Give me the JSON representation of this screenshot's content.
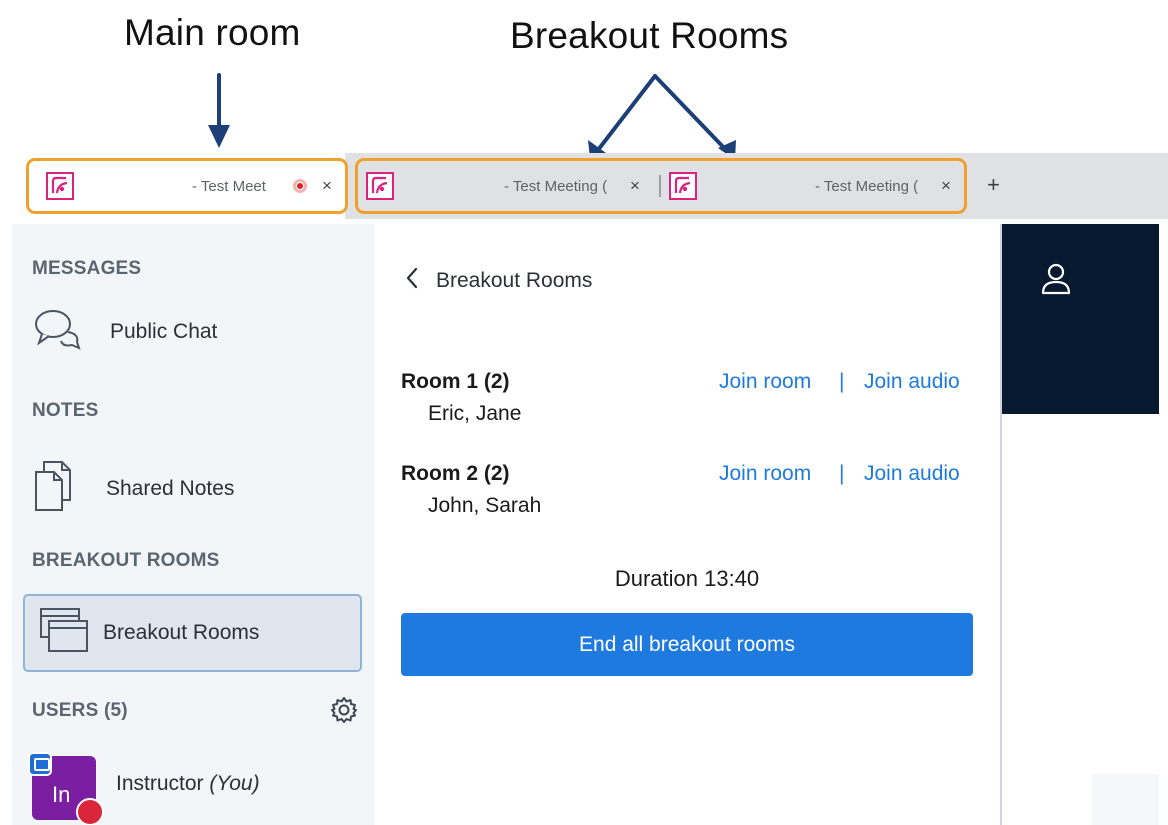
{
  "annotations": {
    "main_room": "Main room",
    "breakout_rooms": "Breakout Rooms"
  },
  "tabs": [
    {
      "title": "- Test Meet",
      "recording": true,
      "close": "×"
    },
    {
      "title": "- Test Meeting (",
      "close": "×"
    },
    {
      "title": "- Test Meeting (",
      "close": "×"
    }
  ],
  "new_tab": "+",
  "sidebar": {
    "messages_title": "MESSAGES",
    "public_chat": "Public Chat",
    "notes_title": "NOTES",
    "shared_notes": "Shared Notes",
    "breakout_title": "BREAKOUT ROOMS",
    "breakout_item": "Breakout Rooms",
    "users_title": "USERS (5)",
    "user": {
      "initials": "In",
      "name": "Instructor",
      "you": "(You)"
    }
  },
  "panel": {
    "title": "Breakout Rooms",
    "rooms": [
      {
        "name": "Room 1 (2)",
        "users": "Eric, Jane",
        "join_room": "Join room",
        "separator": "|",
        "join_audio": "Join audio"
      },
      {
        "name": "Room 2 (2)",
        "users": "John, Sarah",
        "join_room": "Join room",
        "separator": "|",
        "join_audio": "Join audio"
      }
    ],
    "duration": "Duration 13:40",
    "end_button": "End all breakout rooms"
  },
  "colors": {
    "accent": "#1f7ae0",
    "highlight": "#f0a12b",
    "favicon": "#d9237f",
    "dark_header": "#071a2f",
    "avatar": "#7a1fa2"
  },
  "icons": [
    "chat-icon",
    "notes-icon",
    "breakout-icon",
    "gear-icon",
    "user-icon",
    "back-chevron-icon",
    "favicon-icon",
    "recording-icon",
    "close-icon"
  ]
}
